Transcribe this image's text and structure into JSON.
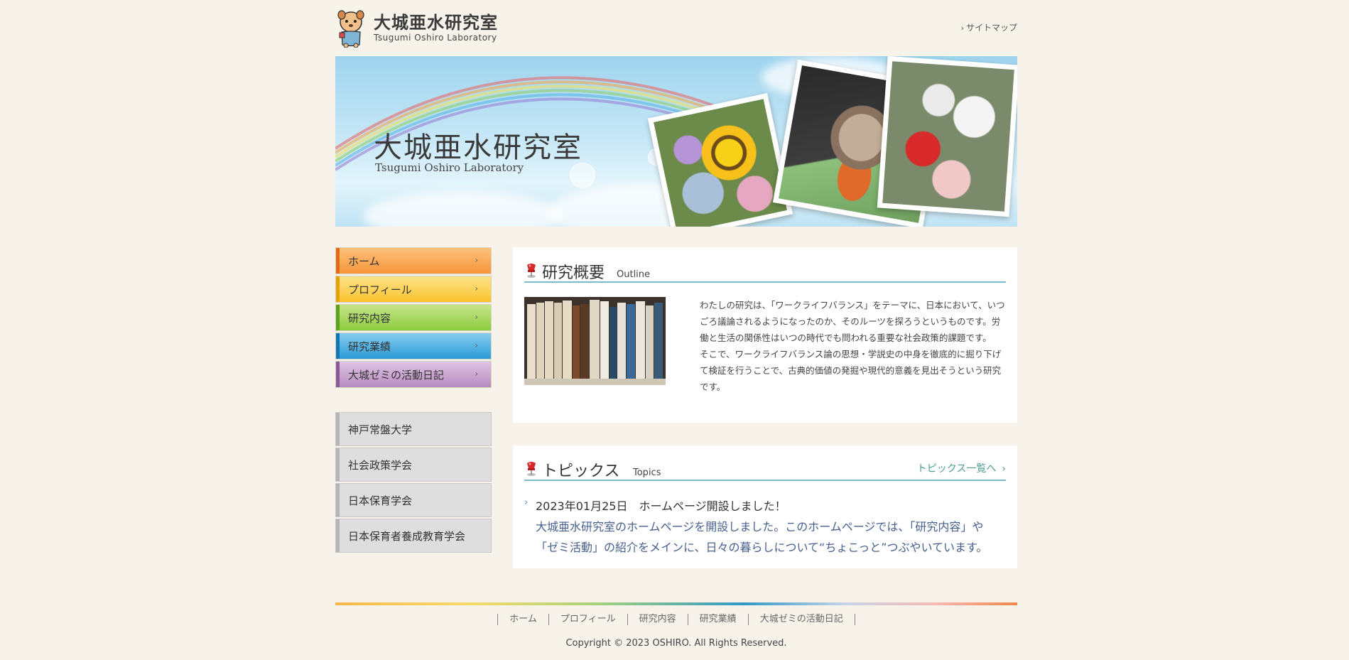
{
  "header": {
    "logo_jp": "大城亜水研究室",
    "logo_en": "Tsugumi Oshiro Laboratory",
    "sitemap": "サイトマップ"
  },
  "hero": {
    "title": "大城亜水研究室",
    "subtitle": "Tsugumi Oshiro Laboratory"
  },
  "nav": {
    "items": [
      {
        "label": "ホーム"
      },
      {
        "label": "プロフィール"
      },
      {
        "label": "研究内容"
      },
      {
        "label": "研究業績"
      },
      {
        "label": "大城ゼミの活動日記"
      }
    ]
  },
  "links": {
    "items": [
      {
        "label": "神戸常盤大学"
      },
      {
        "label": "社会政策学会"
      },
      {
        "label": "日本保育学会"
      },
      {
        "label": "日本保育者養成教育学会"
      }
    ]
  },
  "outline": {
    "title": "研究概要",
    "title_en": "Outline",
    "text1": "わたしの研究は、「ワークライフバランス」をテーマに、日本において、いつごろ議論されるようになったのか、そのルーツを探ろうというものです。労働と生活の関係性はいつの時代でも問われる重要な社会政策的課題です。",
    "text2": "そこで、ワークライフバランス論の思想・学説史の中身を徹底的に掘り下げて検証を行うことで、古典的価値の発掘や現代的意義を見出そうという研究です。"
  },
  "topics": {
    "title": "トピックス",
    "title_en": "Topics",
    "more": "トピックス一覧へ",
    "items": [
      {
        "date_title": "2023年01月25日　ホームページ開設しました！",
        "body": "大城亜水研究室のホームページを開設しました。このホームページでは、「研究内容」や「ゼミ活動」の紹介をメインに、日々の暮らしについて“ちょこっと”つぶやいています。"
      }
    ]
  },
  "footer": {
    "nav": [
      "ホーム",
      "プロフィール",
      "研究内容",
      "研究業績",
      "大城ゼミの活動日記"
    ],
    "copyright": "Copyright © 2023 OSHIRO. All Rights Reserved."
  },
  "colors": {
    "background": "#f7f3ea",
    "accent_line": "#7bbbc9",
    "topics_link": "#4c9d91",
    "topic_body": "#47608e"
  },
  "icons": {
    "pin": "pushpin-icon",
    "chevron": "chevron-right-icon"
  }
}
